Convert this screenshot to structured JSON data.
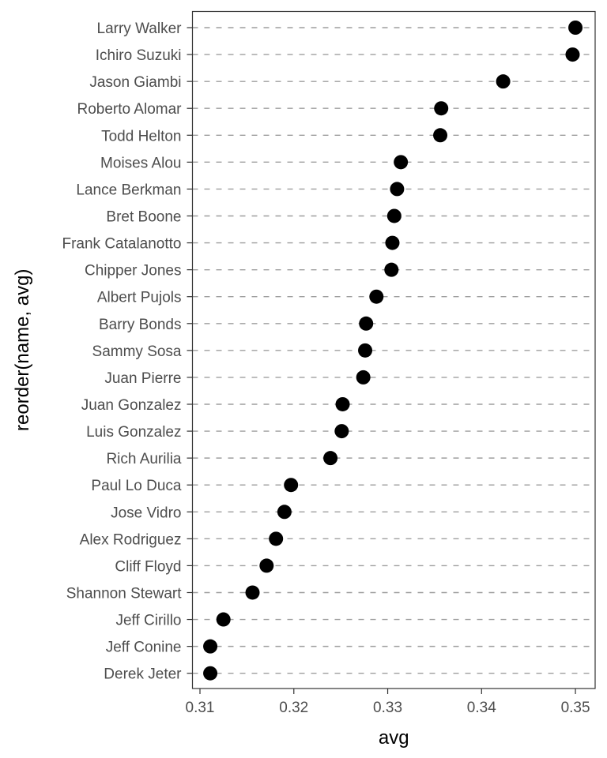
{
  "chart_data": {
    "type": "scatter",
    "subtype": "dot-plot",
    "title": "",
    "xlabel": "avg",
    "ylabel": "reorder(name, avg)",
    "xlim": [
      0.3092,
      0.3521
    ],
    "xticks": [
      0.31,
      0.32,
      0.33,
      0.34,
      0.35
    ],
    "xtick_labels": [
      "0.31",
      "0.32",
      "0.33",
      "0.34",
      "0.35"
    ],
    "grid": "horizontal dashed lines per category",
    "legend": "none",
    "point_color": "#000000",
    "gridline_color": "#9e9e9e",
    "categories": [
      "Larry Walker",
      "Ichiro Suzuki",
      "Jason Giambi",
      "Roberto Alomar",
      "Todd Helton",
      "Moises Alou",
      "Lance Berkman",
      "Bret Boone",
      "Frank Catalanotto",
      "Chipper Jones",
      "Albert Pujols",
      "Barry Bonds",
      "Sammy Sosa",
      "Juan Pierre",
      "Juan Gonzalez",
      "Luis Gonzalez",
      "Rich Aurilia",
      "Paul Lo Duca",
      "Jose Vidro",
      "Alex Rodriguez",
      "Cliff Floyd",
      "Shannon Stewart",
      "Jeff Cirillo",
      "Jeff Conine",
      "Derek Jeter"
    ],
    "values": [
      0.35,
      0.3497,
      0.3423,
      0.3357,
      0.3356,
      0.3314,
      0.331,
      0.3307,
      0.3305,
      0.3304,
      0.3288,
      0.3277,
      0.3276,
      0.3274,
      0.3252,
      0.3251,
      0.3239,
      0.3197,
      0.319,
      0.3181,
      0.3171,
      0.3156,
      0.3125,
      0.3111,
      0.3111
    ]
  }
}
